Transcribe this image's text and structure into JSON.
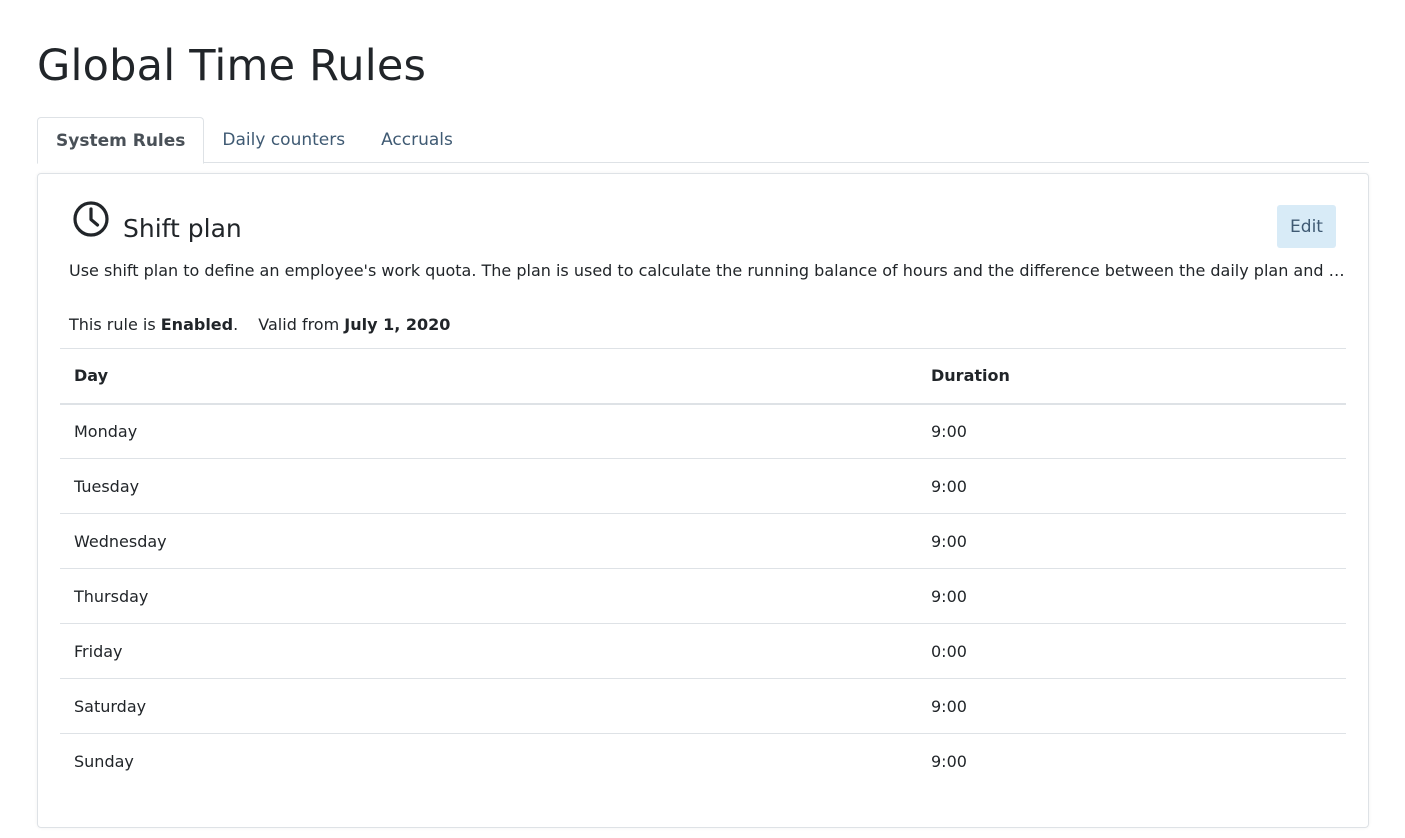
{
  "page": {
    "title": "Global Time Rules"
  },
  "tabs": [
    {
      "label": "System Rules",
      "active": true
    },
    {
      "label": "Daily counters",
      "active": false
    },
    {
      "label": "Accruals",
      "active": false
    }
  ],
  "card": {
    "icon": "clock-icon",
    "title": "Shift plan",
    "edit_label": "Edit",
    "description": "Use shift plan to define an employee's work quota. The plan is used to calculate the running balance of hours and the difference between the daily plan and th...",
    "status_prefix": "This rule is",
    "status_value": "Enabled",
    "status_suffix": ".",
    "valid_prefix": "Valid from",
    "valid_date": "July 1, 2020"
  },
  "table": {
    "headers": {
      "day": "Day",
      "duration": "Duration"
    },
    "rows": [
      {
        "day": "Monday",
        "duration": "9:00"
      },
      {
        "day": "Tuesday",
        "duration": "9:00"
      },
      {
        "day": "Wednesday",
        "duration": "9:00"
      },
      {
        "day": "Thursday",
        "duration": "9:00"
      },
      {
        "day": "Friday",
        "duration": "0:00"
      },
      {
        "day": "Saturday",
        "duration": "9:00"
      },
      {
        "day": "Sunday",
        "duration": "9:00"
      }
    ]
  },
  "colors": {
    "accent_button_bg": "#d8ebf7",
    "link_text": "#3f5a73",
    "border": "#dee2e6"
  }
}
